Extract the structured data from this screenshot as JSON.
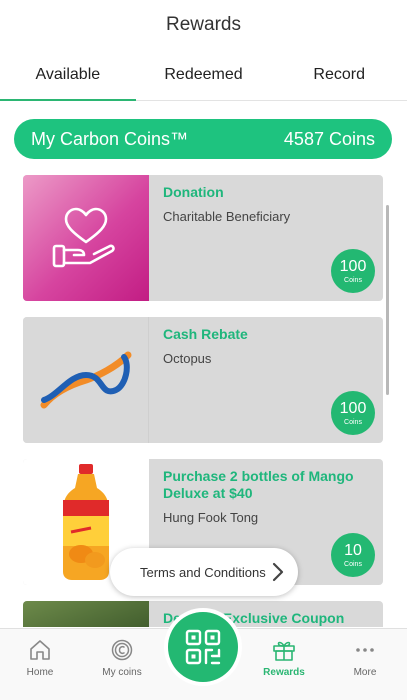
{
  "header": {
    "title": "Rewards"
  },
  "tabs": [
    {
      "label": "Available",
      "active": true
    },
    {
      "label": "Redeemed",
      "active": false
    },
    {
      "label": "Record",
      "active": false
    }
  ],
  "coins_bar": {
    "label": "My Carbon Coins™",
    "value": "4587 Coins"
  },
  "rewards": [
    {
      "title": "Donation",
      "subtitle": "Charitable Beneficiary",
      "coins": "100",
      "coins_label": "Coins",
      "image": "heart-hand-icon"
    },
    {
      "title": "Cash Rebate",
      "subtitle": "Octopus",
      "coins": "100",
      "coins_label": "Coins",
      "image": "octopus-logo"
    },
    {
      "title": "Purchase 2 bottles of Mango Deluxe at $40",
      "subtitle": "Hung Fook Tong",
      "coins": "10",
      "coins_label": "Coins",
      "image": "mango-bottle"
    },
    {
      "title": "Demeter Exclusive Coupon",
      "subtitle": "",
      "coins": "",
      "coins_label": "",
      "image": "forest-photo"
    }
  ],
  "terms": {
    "label": "Terms and Conditions"
  },
  "nav": {
    "home": "Home",
    "my_coins": "My coins",
    "rewards": "Rewards",
    "more": "More",
    "qr": "qr-scan-icon"
  },
  "colors": {
    "accent": "#1ec37f",
    "donation_pink": "#d6449f"
  }
}
